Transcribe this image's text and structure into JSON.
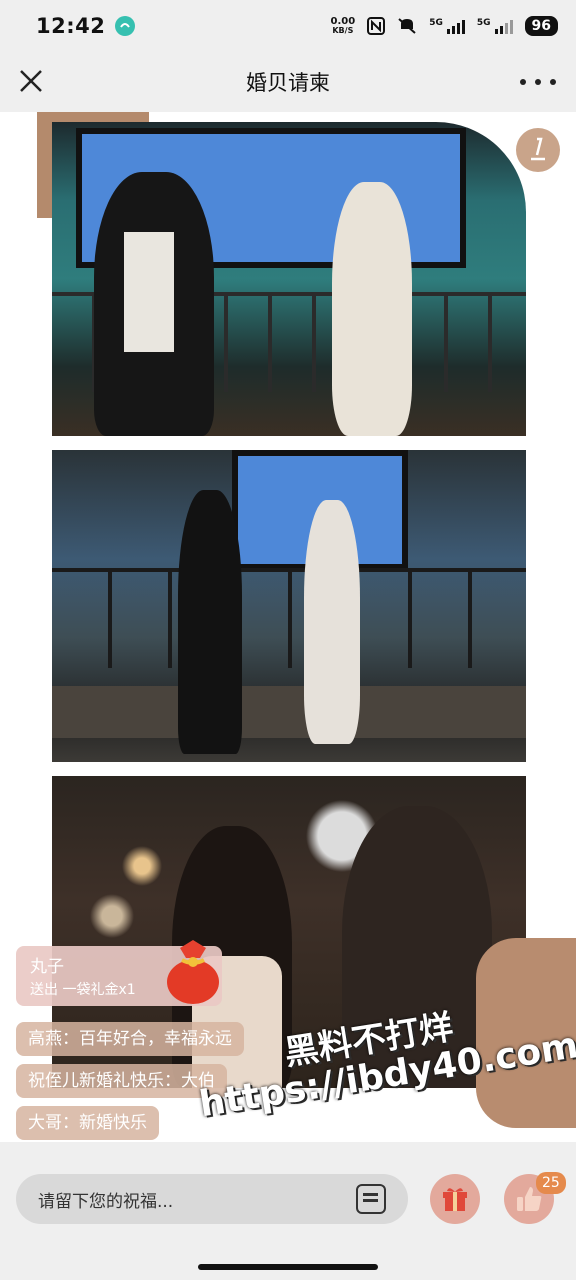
{
  "status_bar": {
    "time": "12:42",
    "net_speed_value": "0.00",
    "net_speed_unit": "KB/S",
    "signal1_label": "5G",
    "signal2_label": "5G",
    "battery": "96"
  },
  "header": {
    "title": "婚贝请柬"
  },
  "danmu": {
    "gift_sender": "丸子",
    "gift_text": "送出 一袋礼金x1",
    "messages": [
      "高燕：百年好合，幸福永远",
      "祝侄儿新婚礼快乐：大伯",
      "大哥：新婚快乐"
    ]
  },
  "watermark": {
    "line1": "黑料不打烊",
    "line2": "https://ibdy40.com"
  },
  "bottom_bar": {
    "input_placeholder": "请留下您的祝福...",
    "like_count": "25"
  },
  "colors": {
    "accent": "#b48a6c",
    "button_bg": "#e3a99c",
    "badge": "#e58a4c"
  }
}
